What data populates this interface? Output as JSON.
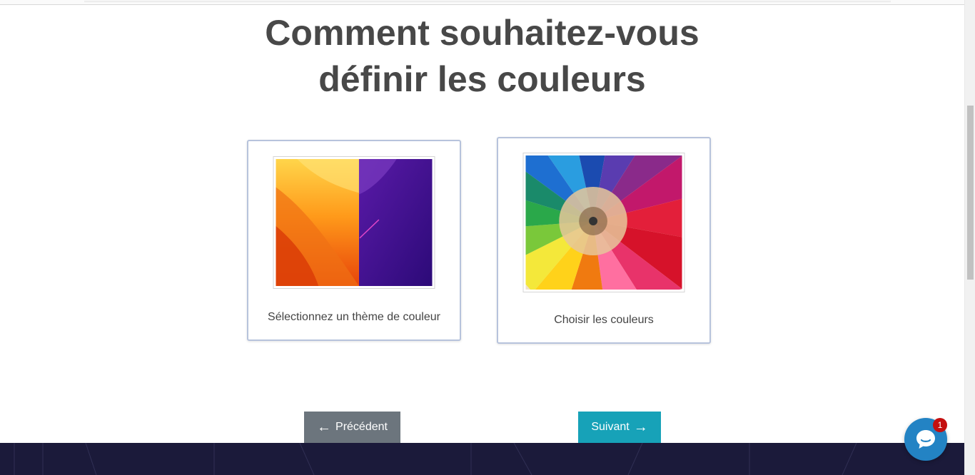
{
  "heading": {
    "line1": "Comment souhaitez-vous",
    "line2": "définir les couleurs"
  },
  "options": [
    {
      "label": "Sélectionnez un thème de couleur",
      "image_icon": "color-theme-thumbnail"
    },
    {
      "label": "Choisir les couleurs",
      "image_icon": "colored-pencils-thumbnail"
    }
  ],
  "navigation": {
    "prev_label": "Précédent",
    "next_label": "Suivant",
    "prev_icon": "arrow-left-icon",
    "next_icon": "arrow-right-icon"
  },
  "chat": {
    "icon": "chat-bubble-icon",
    "unread_count": "1"
  },
  "colors": {
    "prev_button": "#6c757d",
    "next_button": "#17a2b8",
    "card_border": "#b7c3dc",
    "footer": "#1b1a3a",
    "chat_widget": "#2383c4",
    "badge": "#c40f0f"
  }
}
